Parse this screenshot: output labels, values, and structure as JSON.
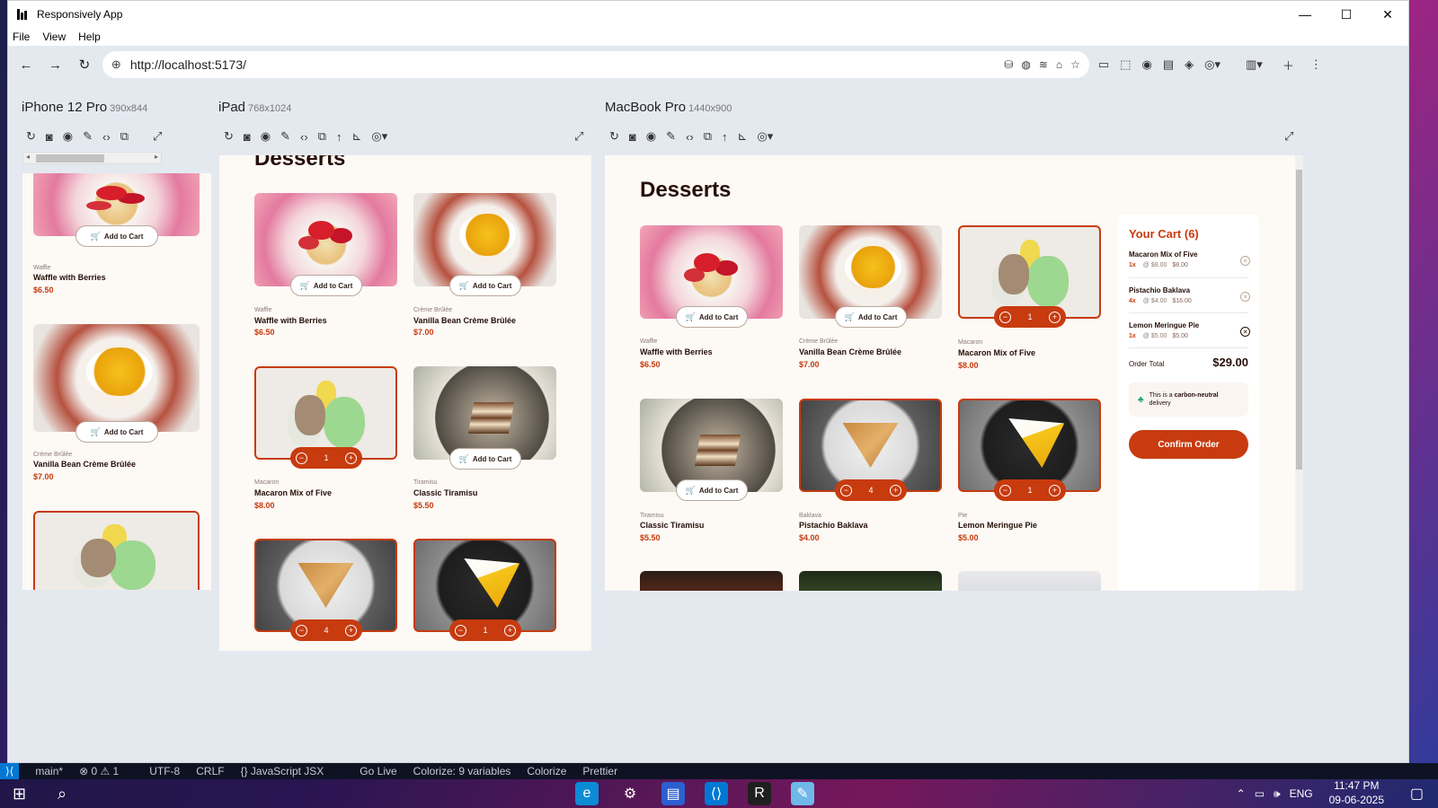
{
  "window": {
    "title": "Responsively App",
    "controls": {
      "minimize": "—",
      "maximize": "☐",
      "close": "✕"
    }
  },
  "menu": [
    "File",
    "View",
    "Help"
  ],
  "toolbar": {
    "url": "http://localhost:5173/",
    "nav_icons": {
      "back": "←",
      "forward": "→",
      "reload": "↻"
    }
  },
  "devices": [
    {
      "name": "iPhone 12 Pro",
      "size": "390x844"
    },
    {
      "name": "iPad",
      "size": "768x1024"
    },
    {
      "name": "MacBook Pro",
      "size": "1440x900"
    }
  ],
  "page": {
    "heading": "Desserts",
    "add_to_cart": "Add to Cart",
    "products": [
      {
        "category": "Waffle",
        "name": "Waffle with Berries",
        "price": "$6.50",
        "image": "waffle"
      },
      {
        "category": "Crème Brûlée",
        "name": "Vanilla Bean Crème Brûlée",
        "price": "$7.00",
        "image": "brulee"
      },
      {
        "category": "Macaron",
        "name": "Macaron Mix of Five",
        "price": "$8.00",
        "image": "macaron",
        "qty": "1"
      },
      {
        "category": "Tiramisu",
        "name": "Classic Tiramisu",
        "price": "$5.50",
        "image": "tiramisu"
      },
      {
        "category": "Baklava",
        "name": "Pistachio Baklava",
        "price": "$4.00",
        "image": "baklava",
        "qty": "4"
      },
      {
        "category": "Pie",
        "name": "Lemon Meringue Pie",
        "price": "$5.00",
        "image": "pie",
        "qty": "1"
      }
    ]
  },
  "cart": {
    "title": "Your Cart (6)",
    "items": [
      {
        "name": "Macaron Mix of Five",
        "qty": "1x",
        "unit": "@ $8.00",
        "total": "$8.00"
      },
      {
        "name": "Pistachio Baklava",
        "qty": "4x",
        "unit": "@ $4.00",
        "total": "$16.00"
      },
      {
        "name": "Lemon Meringue Pie",
        "qty": "1x",
        "unit": "@ $5.00",
        "total": "$5.00"
      }
    ],
    "order_total_label": "Order Total",
    "order_total": "$29.00",
    "carbon_prefix": "This is a",
    "carbon_bold": "carbon-neutral",
    "carbon_suffix": "delivery",
    "confirm_label": "Confirm Order"
  },
  "statusbar": {
    "branch": "main*",
    "errors": "⊗ 0 ⚠ 1",
    "encoding": "UTF-8",
    "eol": "CRLF",
    "language": "{} JavaScript JSX",
    "golive": "Go Live",
    "colorize": "Colorize: 9 variables",
    "colorize2": "Colorize",
    "prettier": "Prettier"
  },
  "taskbar": {
    "lang": "ENG",
    "time": "11:47 PM",
    "date": "09-06-2025"
  },
  "colors": {
    "accent": "#c73b0f",
    "rose900": "#260f08",
    "bg": "#fdf9f5"
  }
}
